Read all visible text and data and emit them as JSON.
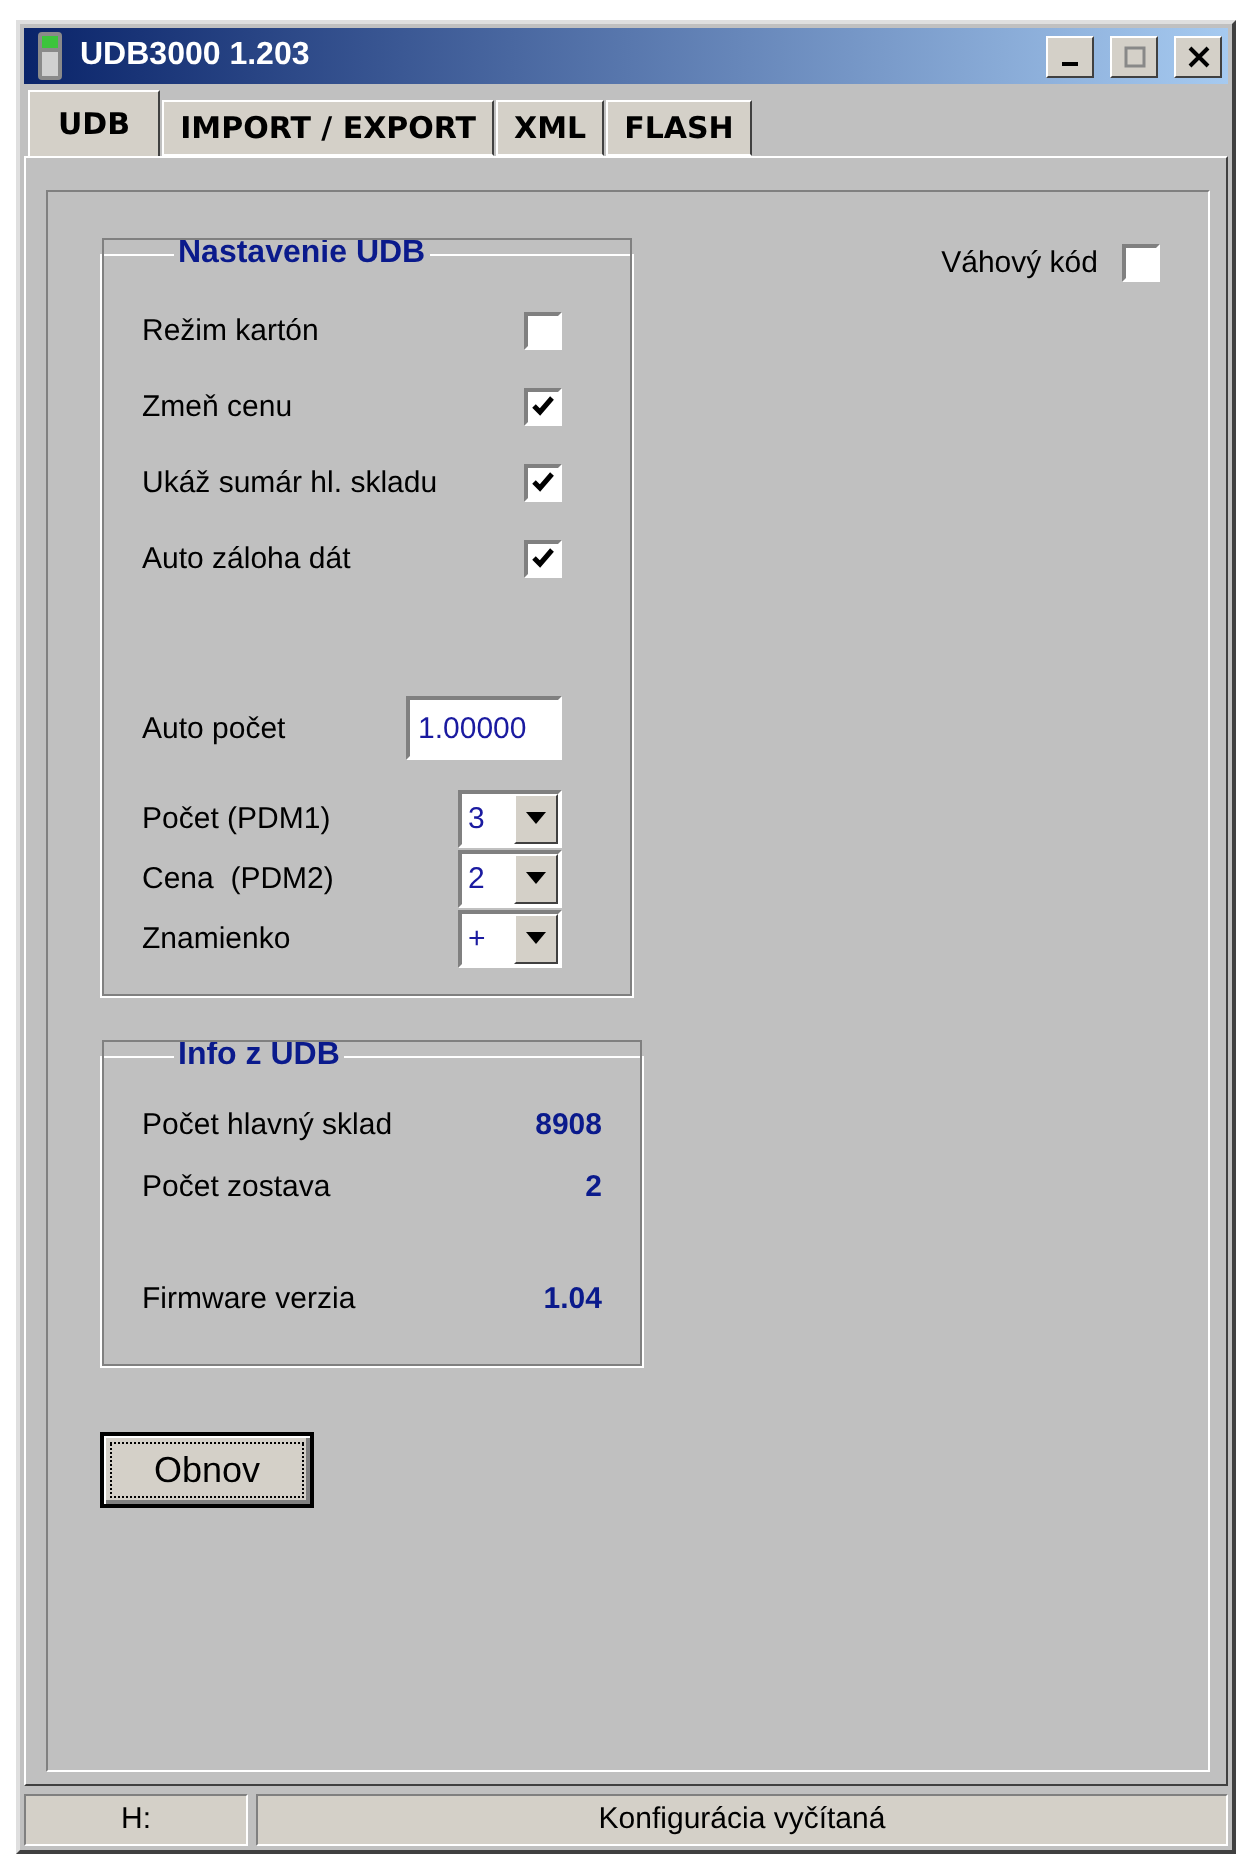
{
  "window": {
    "title": "UDB3000 1.203"
  },
  "tabs": [
    {
      "label": "UDB",
      "selected": true
    },
    {
      "label": "IMPORT / EXPORT",
      "selected": false
    },
    {
      "label": "XML",
      "selected": false
    },
    {
      "label": "FLASH",
      "selected": false
    }
  ],
  "settings_group": {
    "title": "Nastavenie UDB",
    "checkboxes": [
      {
        "label": "Režim kartón",
        "checked": false
      },
      {
        "label": "Zmeň cenu",
        "checked": true
      },
      {
        "label": "Ukáž sumár hl. skladu",
        "checked": true
      },
      {
        "label": "Auto záloha dát",
        "checked": true
      }
    ],
    "auto_count": {
      "label": "Auto počet",
      "value": "1.00000"
    },
    "dropdowns": [
      {
        "label": "Počet (PDM1)",
        "value": "3"
      },
      {
        "label": "Cena  (PDM2)",
        "value": "2"
      },
      {
        "label": "Znamienko",
        "value": "+"
      }
    ]
  },
  "weight_code": {
    "label": "Váhový kód",
    "checked": false
  },
  "info_group": {
    "title": "Info z UDB",
    "rows": [
      {
        "label": "Počet hlavný sklad",
        "value": "8908"
      },
      {
        "label": "Počet zostava",
        "value": "2"
      },
      {
        "label": "Firmware verzia",
        "value": "1.04"
      }
    ]
  },
  "refresh_button": "Obnov",
  "status_bar": [
    "H:",
    "Konfigurácia vyčítaná"
  ]
}
